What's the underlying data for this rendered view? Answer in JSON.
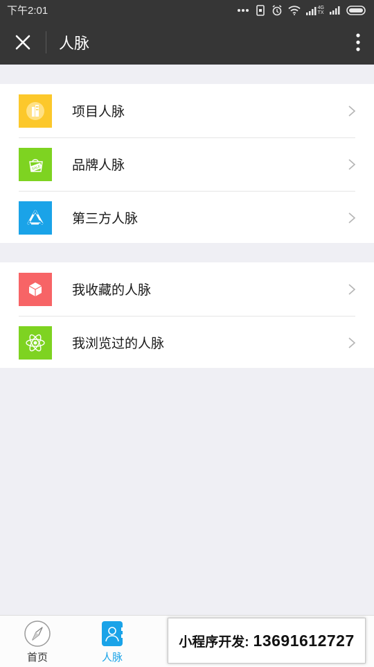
{
  "status_bar": {
    "time": "下午2:01",
    "icons": [
      "more-dots-icon",
      "screen-rotate-icon",
      "alarm-icon",
      "wifi-icon",
      "signal-4g-icon",
      "signal-icon",
      "battery-icon"
    ],
    "network_label_top": "4G",
    "network_label_bottom": "TX"
  },
  "nav": {
    "title": "人脉",
    "close_icon": "close-icon",
    "more_icon": "more-vertical-icon"
  },
  "group1": [
    {
      "label": "项目人脉",
      "icon": "building-icon",
      "color": "#fcc82b"
    },
    {
      "label": "品牌人脉",
      "icon": "sale-tag-icon",
      "color": "#7ed321"
    },
    {
      "label": "第三方人脉",
      "icon": "recycle-triangle-icon",
      "color": "#1aa3e8"
    }
  ],
  "group2": [
    {
      "label": "我收藏的人脉",
      "icon": "cube-icon",
      "color": "#f76466"
    },
    {
      "label": "我浏览过的人脉",
      "icon": "atom-icon",
      "color": "#7ed321"
    }
  ],
  "tabs": [
    {
      "label": "首页",
      "icon": "compass-icon",
      "active": false
    },
    {
      "label": "人脉",
      "icon": "contacts-icon",
      "active": true
    }
  ],
  "ad": {
    "label": "小程序开发:",
    "phone": "13691612727"
  },
  "colors": {
    "header_bg": "#363636",
    "page_bg": "#efeff4",
    "active_tab": "#1aa3e8"
  }
}
